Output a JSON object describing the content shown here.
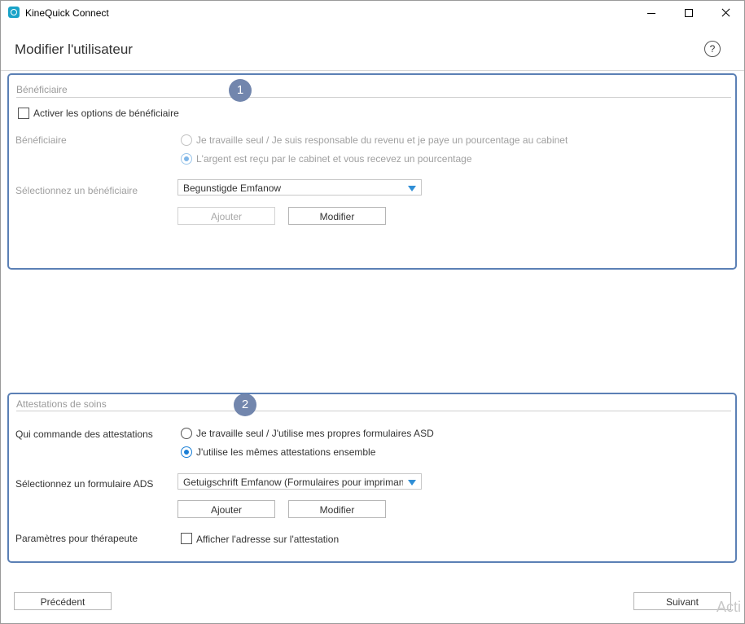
{
  "window": {
    "title": "KineQuick Connect"
  },
  "header": {
    "title": "Modifier l'utilisateur",
    "help": "?"
  },
  "section1": {
    "badge": "1",
    "legend": "Bénéficiaire",
    "activate_label": "Activer les options de bénéficiaire",
    "beneficiary_label": "Bénéficiaire",
    "radio1": "Je travaille seul / Je suis responsable du revenu et je paye un pourcentage au cabinet",
    "radio2": "L'argent est reçu par le cabinet et vous recevez un pourcentage",
    "select_label": "Sélectionnez un bénéficiaire",
    "select_value": "Begunstigde Emfanow",
    "add": "Ajouter",
    "edit": "Modifier"
  },
  "section2": {
    "badge": "2",
    "legend": "Attestations de soins",
    "who_label": "Qui commande des attestations",
    "radio1": "Je travaille seul / J'utilise mes propres formulaires ASD",
    "radio2": "J'utilise les mêmes attestations ensemble",
    "form_label": "Sélectionnez un formulaire ADS",
    "form_value": "Getuigschrift Emfanow (Formulaires pour imprimante)",
    "add": "Ajouter",
    "edit": "Modifier",
    "params_label": "Paramètres pour thérapeute",
    "address_label": "Afficher l'adresse sur l'attestation"
  },
  "footer": {
    "previous": "Précédent",
    "next": "Suivant",
    "watermark": "Acti"
  },
  "icons": {
    "app": "kinequick-logo-icon",
    "minimize": "minimize-icon",
    "maximize": "maximize-icon",
    "close": "close-icon",
    "help": "help-icon",
    "dropdown": "chevron-down-icon"
  },
  "colors": {
    "section_border": "#5b80b5",
    "badge": "#7286ad",
    "accent": "#1a7fd6"
  }
}
